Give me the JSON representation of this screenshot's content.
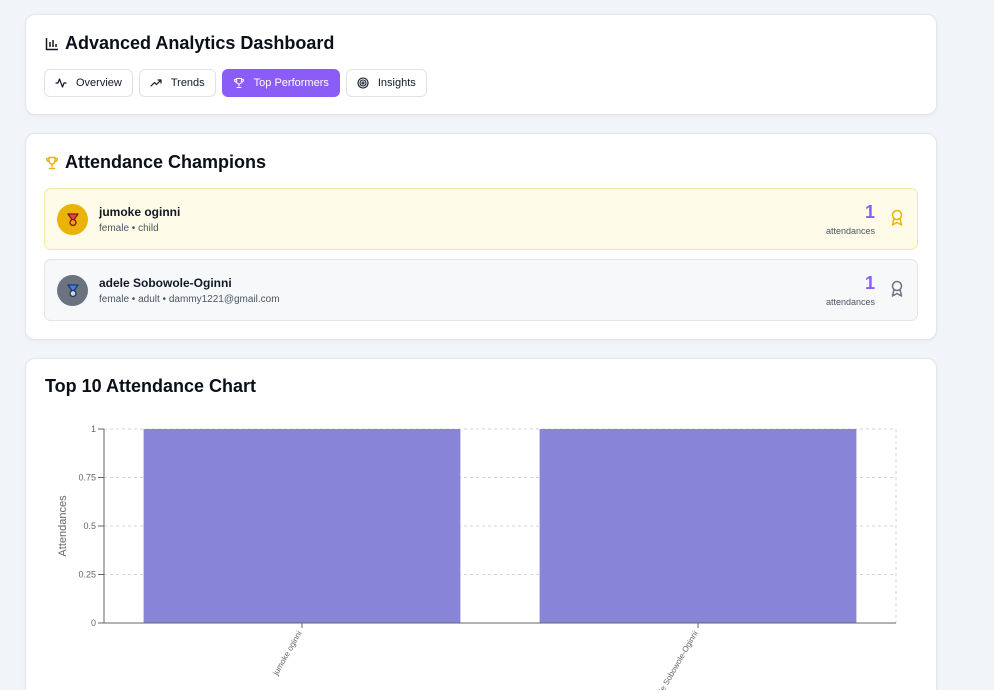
{
  "header": {
    "title": "Advanced Analytics Dashboard",
    "tabs": [
      {
        "label": "Overview",
        "icon": "activity-icon",
        "active": false
      },
      {
        "label": "Trends",
        "icon": "trending-up-icon",
        "active": false
      },
      {
        "label": "Top Performers",
        "icon": "trophy-icon",
        "active": true
      },
      {
        "label": "Insights",
        "icon": "target-icon",
        "active": false
      }
    ]
  },
  "champions": {
    "title": "Attendance Champions",
    "items": [
      {
        "name": "jumoke oginni",
        "meta": "female • child",
        "count": "1",
        "unit": "attendances",
        "medal": "gold"
      },
      {
        "name": "adele Sobowole-Oginni",
        "meta": "female • adult • dammy1221@gmail.com",
        "count": "1",
        "unit": "attendances",
        "medal": "silver"
      }
    ]
  },
  "chart": {
    "title": "Top 10 Attendance Chart"
  },
  "colors": {
    "accent": "#8b5cf6",
    "bar": "#8884d8",
    "gold": "#eab308",
    "silver": "#6b7280"
  },
  "chart_data": {
    "type": "bar",
    "categories": [
      "jumoke oginni",
      "adele Sobowole-Oginni"
    ],
    "values": [
      1,
      1
    ],
    "title": "Top 10 Attendance Chart",
    "xlabel": "",
    "ylabel": "Attendances",
    "ylim": [
      0,
      1
    ],
    "yticks": [
      "0",
      "0.25",
      "0.5",
      "0.75",
      "1"
    ],
    "grid": true
  }
}
